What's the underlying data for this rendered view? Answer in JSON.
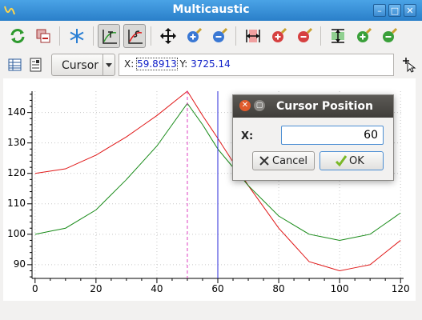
{
  "window": {
    "title": "Multicaustic"
  },
  "controls": {
    "minimize": "–",
    "maximize": "□",
    "close": "✕"
  },
  "toolbar": {
    "icons": [
      "refresh-icon",
      "copy-icon",
      "snowflake-icon",
      "trace-icon",
      "select-icon",
      "pan-icon",
      "zoom-in-icon",
      "zoom-out-icon",
      "fit-horizontal-icon",
      "zoom-in-h-icon",
      "zoom-out-h-icon",
      "fit-vertical-icon",
      "zoom-in-v-icon",
      "zoom-out-v-icon"
    ]
  },
  "mode": {
    "selected": "Cursor"
  },
  "cursor": {
    "x_label": "X:",
    "x_value": "59.8913",
    "y_label": "Y:",
    "y_value": "3725.14"
  },
  "dialog": {
    "title": "Cursor Position",
    "x_label": "X:",
    "x_value": "60",
    "cancel_label": "Cancel",
    "ok_label": "OK"
  },
  "colors": {
    "series_red": "#e01818",
    "series_green": "#178a17",
    "marker_magenta": "#e040c0",
    "cursor_blue": "#2828d8"
  },
  "chart_data": {
    "type": "line",
    "title": "",
    "xlabel": "",
    "ylabel": "",
    "xlim": [
      -1,
      121
    ],
    "ylim": [
      85.5,
      147
    ],
    "x_ticks": [
      0,
      20,
      40,
      60,
      80,
      100,
      120
    ],
    "y_ticks": [
      90,
      100,
      110,
      120,
      130,
      140
    ],
    "grid": true,
    "series": [
      {
        "color": "red",
        "x": [
          0,
          10,
          20,
          30,
          40,
          50,
          55,
          60,
          70,
          80,
          90,
          100,
          110,
          120
        ],
        "y": [
          120,
          121.5,
          126,
          132,
          139,
          147,
          139,
          131.5,
          116,
          102,
          91,
          88,
          90,
          98
        ]
      },
      {
        "color": "green",
        "x": [
          0,
          10,
          20,
          30,
          40,
          50,
          55,
          60,
          70,
          80,
          90,
          100,
          110,
          120
        ],
        "y": [
          100,
          102,
          108,
          118,
          129,
          143,
          136,
          128,
          116,
          106,
          100,
          98,
          100,
          107
        ]
      }
    ],
    "vertical_markers": [
      {
        "x": 50,
        "style": "dashed",
        "color": "magenta"
      },
      {
        "x": 60,
        "style": "solid",
        "color": "blue"
      }
    ]
  }
}
